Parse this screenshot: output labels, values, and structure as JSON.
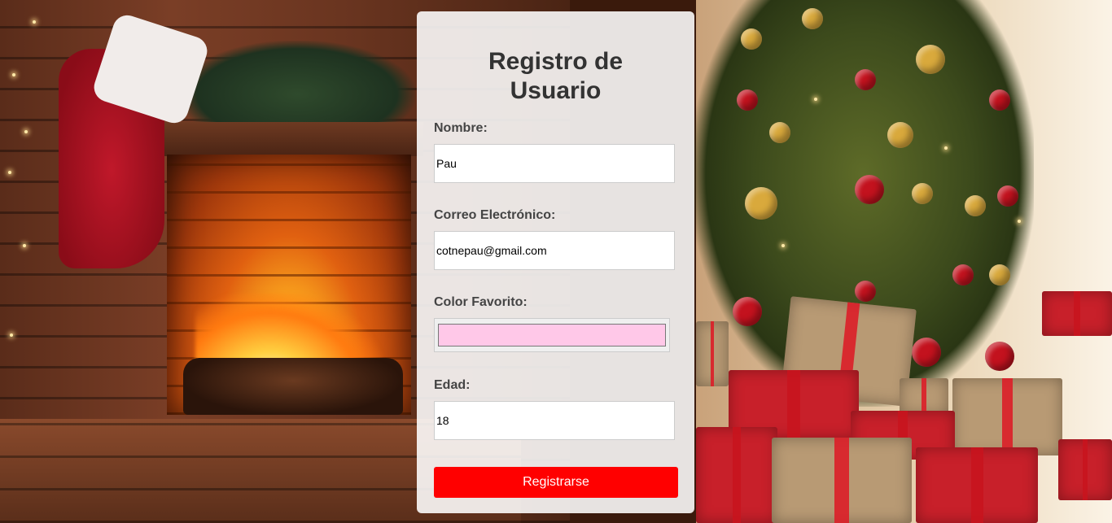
{
  "form": {
    "title_line1": "Registro de",
    "title_line2": "Usuario",
    "fields": {
      "nombre": {
        "label": "Nombre:",
        "value": "Pau"
      },
      "correo": {
        "label": "Correo Electrónico:",
        "value": "cotnepau@gmail.com"
      },
      "color": {
        "label": "Color Favorito:",
        "value": "#ffc8e8"
      },
      "edad": {
        "label": "Edad:",
        "value": "18"
      }
    },
    "submit_label": "Registrarse"
  },
  "colors": {
    "button": "#ff0000",
    "card_background": "rgba(255,255,255,0.88)"
  }
}
